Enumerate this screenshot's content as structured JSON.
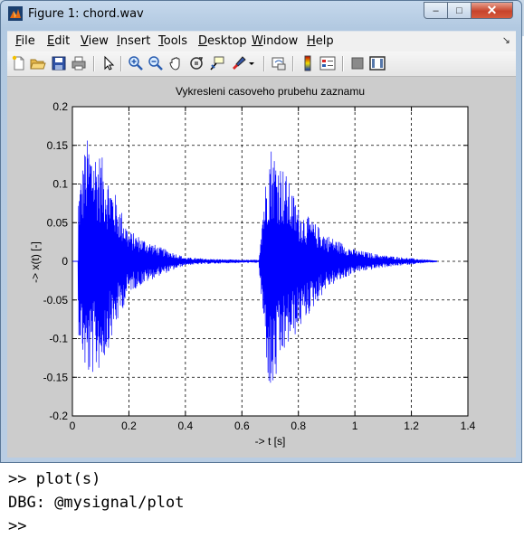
{
  "window": {
    "title": "Figure 1: chord.wav",
    "icon": "matlab-figure-icon",
    "controls": {
      "minimize": "–",
      "maximize": "□",
      "close": "✕"
    }
  },
  "menubar": {
    "items": [
      {
        "label_u": "F",
        "label_rest": "ile"
      },
      {
        "label_u": "E",
        "label_rest": "dit"
      },
      {
        "label_u": "V",
        "label_rest": "iew"
      },
      {
        "label_u": "I",
        "label_rest": "nsert"
      },
      {
        "label_u": "T",
        "label_rest": "ools"
      },
      {
        "label_u": "D",
        "label_rest": "esktop"
      },
      {
        "label_u": "W",
        "label_rest": "indow"
      },
      {
        "label_u": "H",
        "label_rest": "elp"
      }
    ],
    "dock_arrow": "↘"
  },
  "toolbar": {
    "buttons": [
      "new-figure-icon",
      "open-file-icon",
      "save-icon",
      "print-icon",
      "edit-plot-arrow-icon",
      "zoom-in-icon",
      "zoom-out-icon",
      "pan-hand-icon",
      "rotate-3d-icon",
      "data-cursor-icon",
      "brush-icon",
      "brush-dropdown-icon",
      "link-plot-icon",
      "insert-colorbar-icon",
      "insert-legend-icon",
      "hide-plot-tools-icon",
      "show-plot-tools-icon"
    ]
  },
  "chart_data": {
    "type": "line",
    "title": "Vykresleni casoveho prubehu zaznamu",
    "xlabel": "-> t [s]",
    "ylabel": "-> x(t) [-]",
    "xlim": [
      0,
      1.4
    ],
    "ylim": [
      -0.2,
      0.2
    ],
    "xticks": [
      "0",
      "0.2",
      "0.4",
      "0.6",
      "0.8",
      "1",
      "1.2",
      "1.4"
    ],
    "yticks": [
      "0.2",
      "0.15",
      "0.1",
      "0.05",
      "0",
      "-0.05",
      "-0.1",
      "-0.15",
      "-0.2"
    ],
    "grid": true,
    "line_color": "#0000ff",
    "series": [
      {
        "x": [
          0.02,
          0.05,
          0.1,
          0.15,
          0.2,
          0.3,
          0.4,
          0.5,
          0.6,
          0.66,
          0.67,
          0.7,
          0.75,
          0.8,
          0.9,
          1.0,
          1.1,
          1.2,
          1.29
        ],
        "upper": [
          0.09,
          0.16,
          0.14,
          0.09,
          0.04,
          0.02,
          0.005,
          0.003,
          0.002,
          0.002,
          0.06,
          0.155,
          0.12,
          0.07,
          0.035,
          0.015,
          0.008,
          0.004,
          0.001
        ],
        "lower": [
          -0.09,
          -0.155,
          -0.14,
          -0.09,
          -0.04,
          -0.02,
          -0.005,
          -0.003,
          -0.002,
          -0.002,
          -0.06,
          -0.185,
          -0.12,
          -0.09,
          -0.035,
          -0.015,
          -0.008,
          -0.004,
          -0.001
        ]
      }
    ]
  },
  "console": {
    "lines": [
      ">> plot(s)",
      "DBG: @mysignal/plot",
      ">>"
    ]
  }
}
